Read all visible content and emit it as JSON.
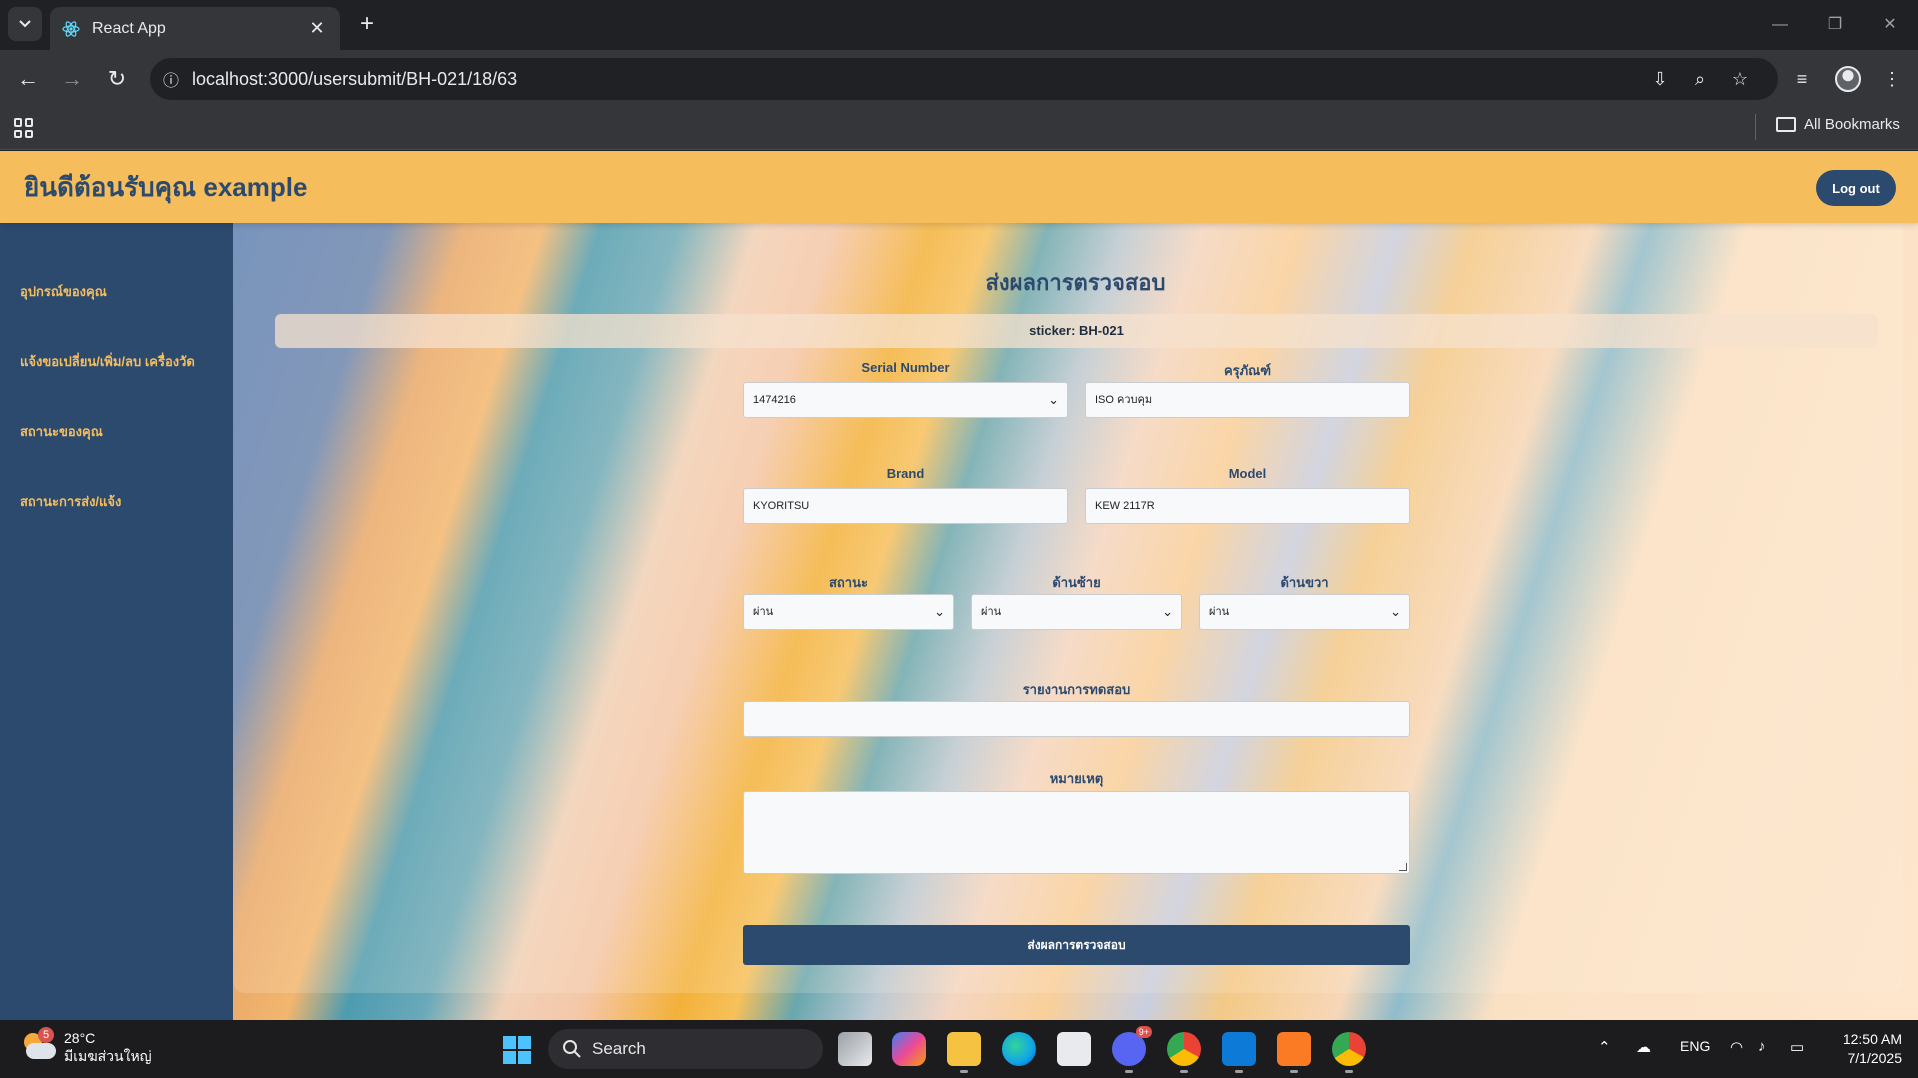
{
  "browser": {
    "tab_title": "React App",
    "url": "localhost:3000/usersubmit/BH-021/18/63",
    "bookmarks_label": "All Bookmarks"
  },
  "app": {
    "welcome": "ยินดีต้อนรับคุณ example",
    "logout_label": "Log out",
    "sidebar": [
      {
        "label": "อุปกรณ์ของคุณ"
      },
      {
        "label": "แจ้งขอเปลี่ยน/เพิ่ม/ลบ เครื่องวัด"
      },
      {
        "label": "สถานะของคุณ"
      },
      {
        "label": "สถานะการส่ง/แจ้ง"
      }
    ]
  },
  "form": {
    "title": "ส่งผลการตรวจสอบ",
    "sticker": "sticker: BH-021",
    "serial_label": "Serial Number",
    "serial_value": "1474216",
    "equipment_label": "ครุภัณฑ์",
    "equipment_value": "ISO ควบคุม",
    "brand_label": "Brand",
    "brand_value": "KYORITSU",
    "model_label": "Model",
    "model_value": "KEW 2117R",
    "status_label": "สถานะ",
    "status_value": "ผ่าน",
    "left_label": "ด้านซ้าย",
    "left_value": "ผ่าน",
    "right_label": "ด้านขวา",
    "right_value": "ผ่าน",
    "report_label": "รายงานการทดสอบ",
    "report_value": "",
    "note_label": "หมายเหตุ",
    "note_value": "",
    "submit_label": "ส่งผลการตรวจสอบ"
  },
  "taskbar": {
    "weather_badge": "5",
    "temperature": "28°C",
    "weather_desc": "มีเมฆส่วนใหญ่",
    "search_label": "Search",
    "discord_badge": "9+",
    "language": "ENG",
    "time": "12:50 AM",
    "date": "7/1/2025"
  },
  "colors": {
    "header": "#f6bd5c",
    "navy": "#2c4a6e"
  }
}
